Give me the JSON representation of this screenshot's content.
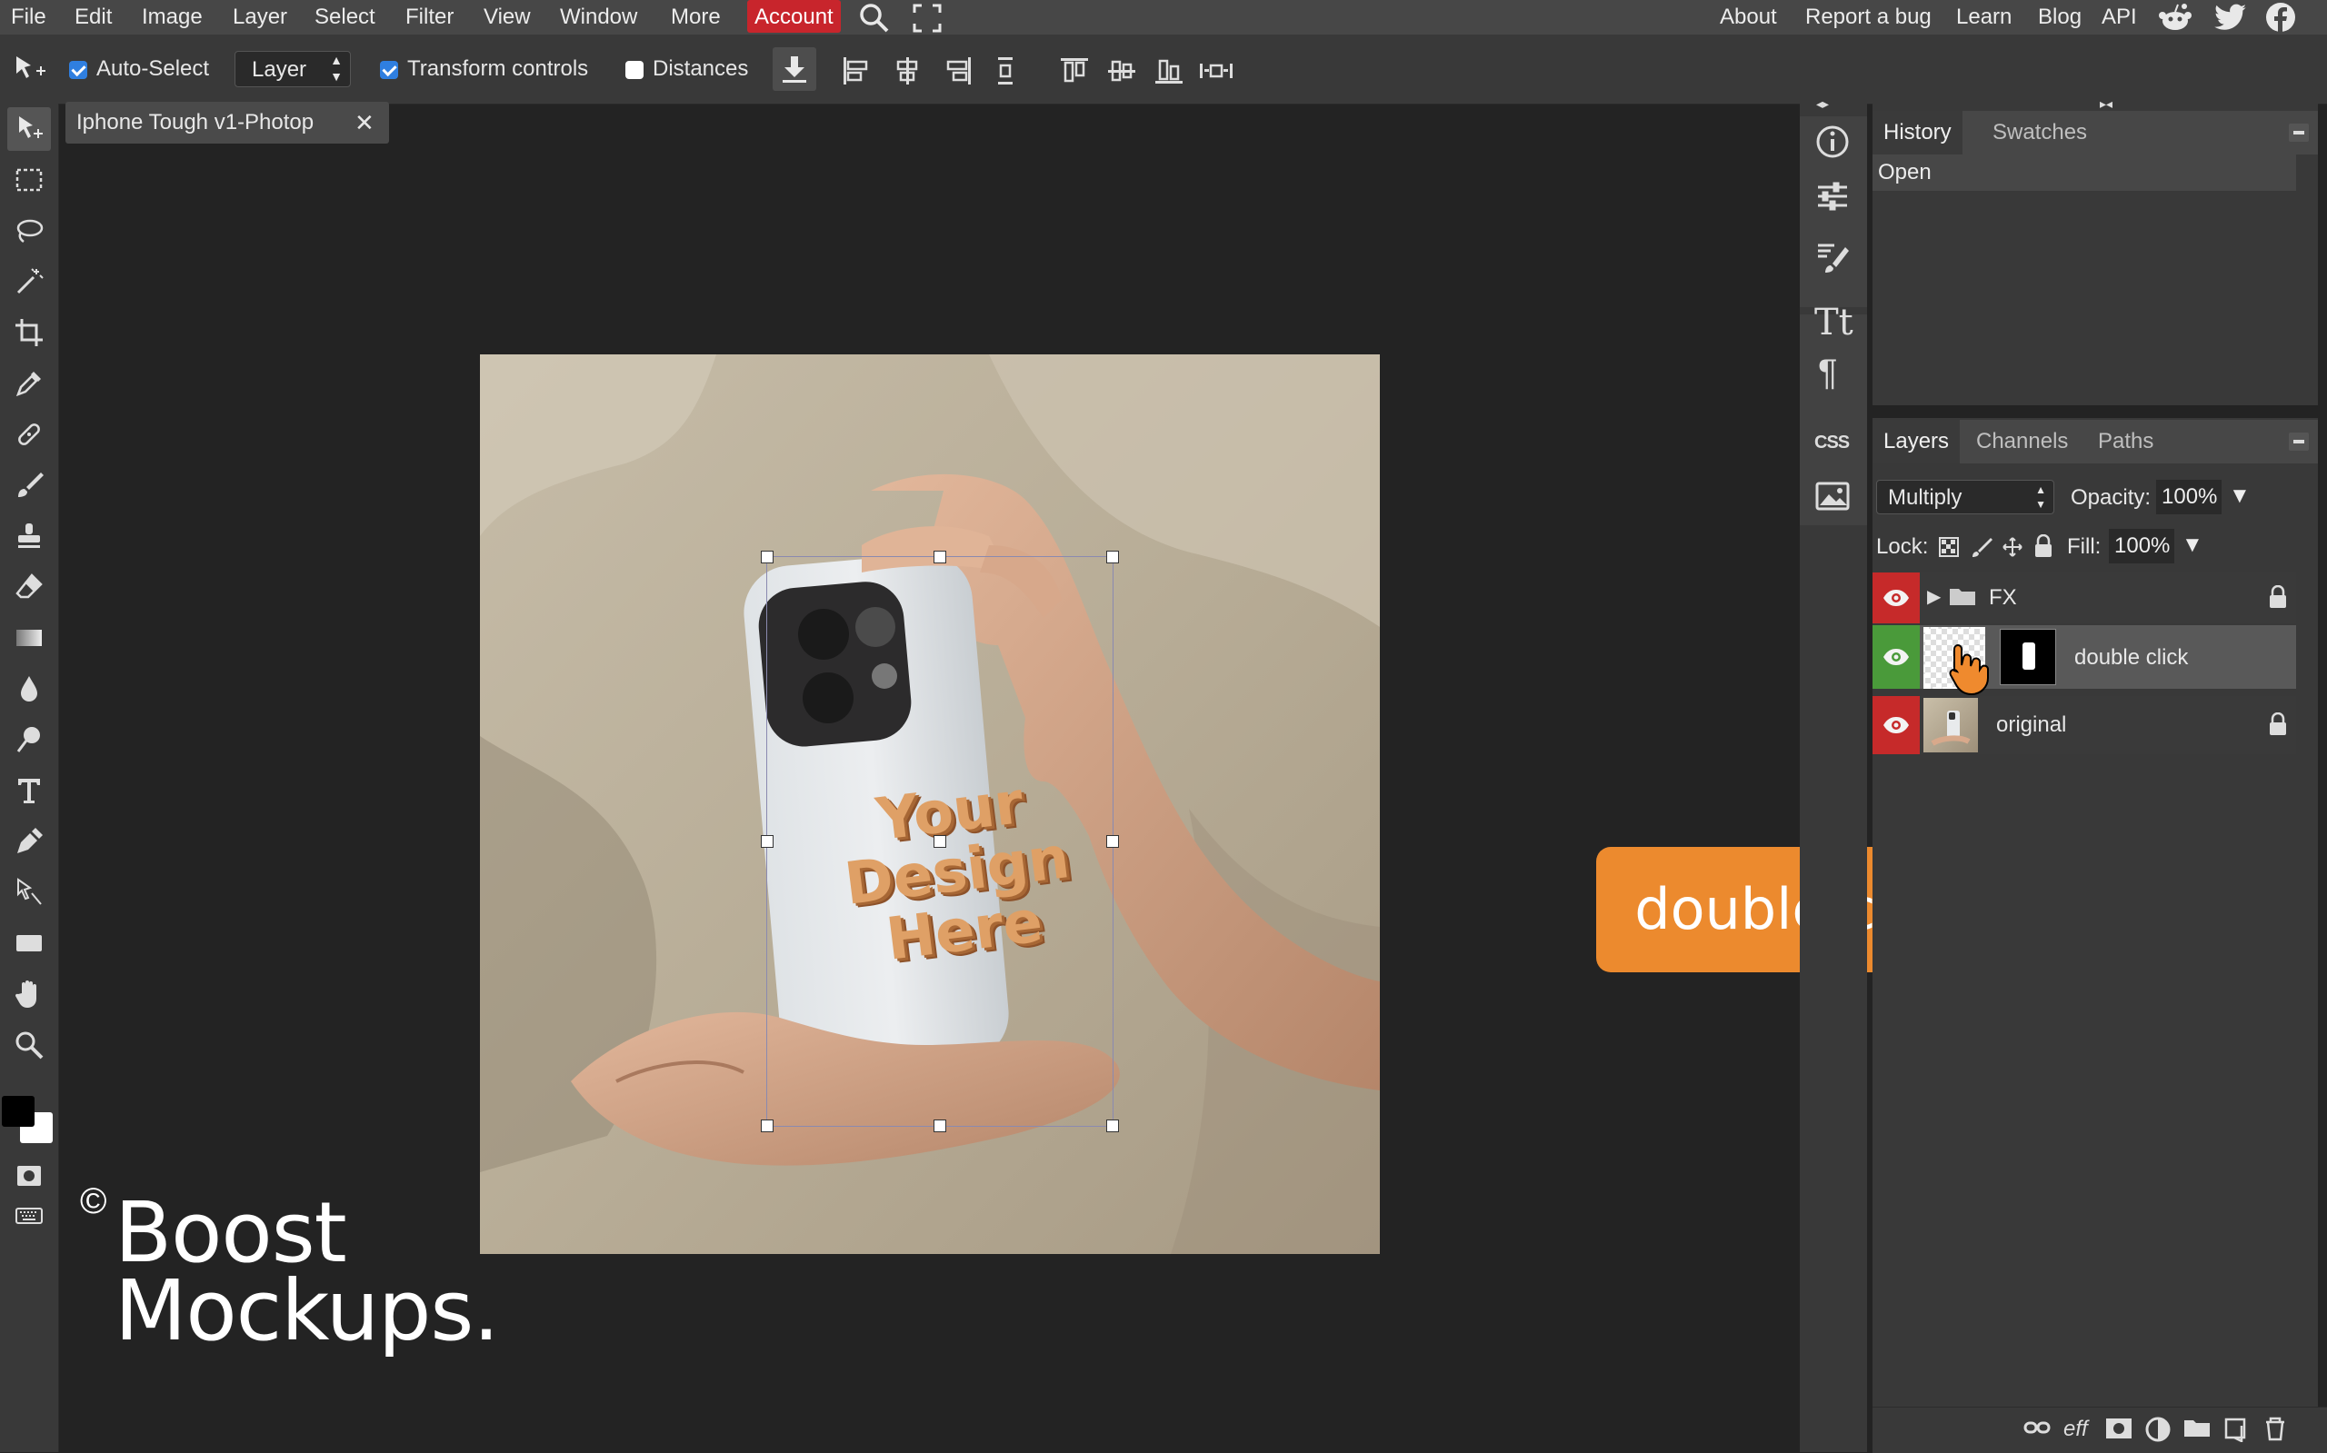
{
  "menu": {
    "items": [
      "File",
      "Edit",
      "Image",
      "Layer",
      "Select",
      "Filter",
      "View",
      "Window",
      "More",
      "Account"
    ],
    "right_items": [
      "About",
      "Report a bug",
      "Learn",
      "Blog",
      "API"
    ],
    "active_color": "#c8252c"
  },
  "options": {
    "auto_select": "Auto-Select",
    "auto_select_checked": true,
    "layer_select": "Layer",
    "transform_controls": "Transform controls",
    "transform_checked": true,
    "distances": "Distances",
    "distances_checked": false
  },
  "document": {
    "tab_title": "Iphone Tough v1-Photop",
    "close_glyph": "✕"
  },
  "canvas": {
    "case_text": [
      "Your",
      "Design",
      "Here"
    ]
  },
  "history_panel": {
    "tabs": [
      "History",
      "Swatches"
    ],
    "items": [
      "Open"
    ]
  },
  "layers_panel": {
    "tabs": [
      "Layers",
      "Channels",
      "Paths"
    ],
    "blend_mode": "Multiply",
    "opacity_label": "Opacity:",
    "opacity_value": "100%",
    "lock_label": "Lock:",
    "fill_label": "Fill:",
    "fill_value": "100%",
    "layers": [
      {
        "name": "FX",
        "type": "group",
        "locked": true
      },
      {
        "name": "double click",
        "type": "smart",
        "locked": false,
        "selected": true
      },
      {
        "name": "original",
        "type": "image",
        "locked": true
      }
    ],
    "footer_eff": "eff"
  },
  "iconcol": {
    "css_label": "CSS",
    "text_glyph": "Tt",
    "para_glyph": "¶"
  },
  "callout": {
    "text": "double click",
    "color": "#ec8a2e"
  },
  "watermark": {
    "copyright": "©",
    "line1": "Boost",
    "line2": "Mockups."
  },
  "colors": {
    "visible_eye": "#c62a2a",
    "selected_eye": "#4a9a3a"
  }
}
